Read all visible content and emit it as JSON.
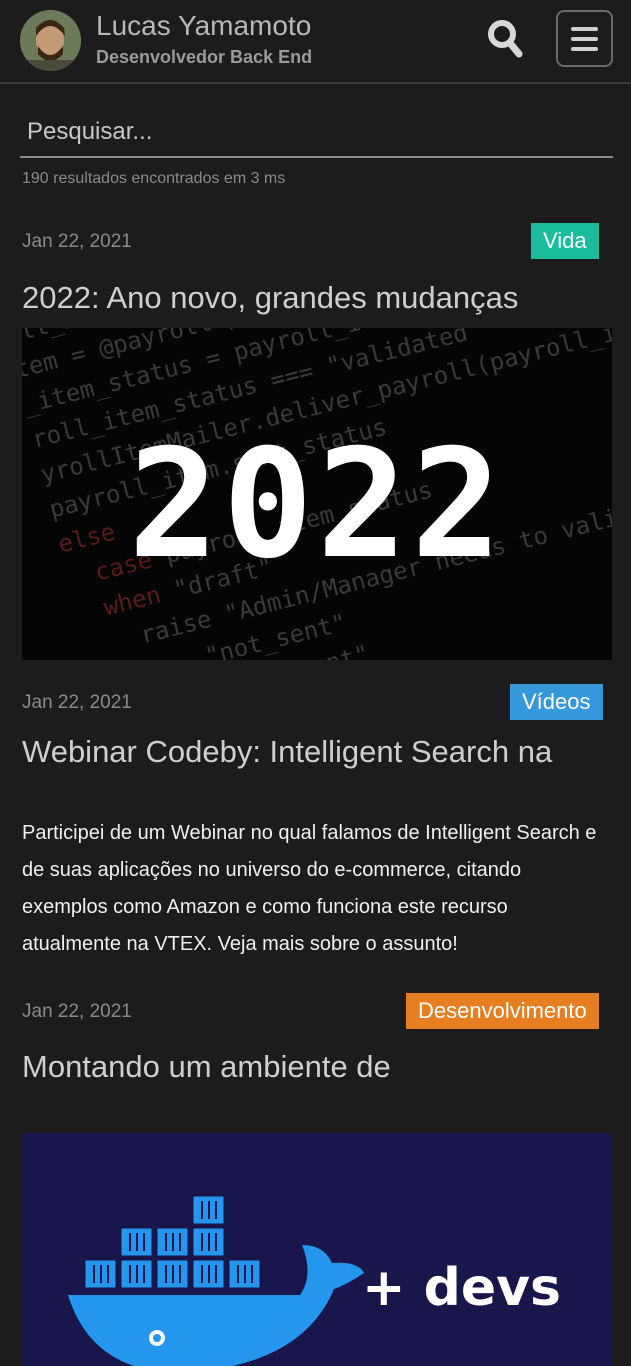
{
  "header": {
    "name": "Lucas Yamamoto",
    "role": "Desenvolvedor Back End"
  },
  "search": {
    "placeholder": "Pesquisar...",
    "results_text": "190 resultados encontrados em 3 ms"
  },
  "posts": [
    {
      "date": "Jan 22, 2021",
      "tag": "Vida",
      "tag_color": "#1abc9c",
      "title": "2022: Ano novo, grandes mudanças",
      "image_text": "2022"
    },
    {
      "date": "Jan 22, 2021",
      "tag": "Vídeos",
      "tag_color": "#3498db",
      "title": "Webinar Codeby: Intelligent Search na",
      "description": "Participei de um Webinar no qual falamos de Intelligent Search e de suas aplicações no universo do e-commerce, citando exemplos como Amazon e como funciona este recurso atualmente na VTEX. Veja mais sobre o assunto!"
    },
    {
      "date": "Jan 22, 2021",
      "tag": "Desenvolvimento",
      "tag_color": "#e67e22",
      "title": "Montando um ambiente de",
      "image_text": "+ devs"
    }
  ],
  "icons": {
    "search": "search-icon",
    "menu": "hamburger-menu-icon",
    "docker": "docker-whale-icon"
  }
}
